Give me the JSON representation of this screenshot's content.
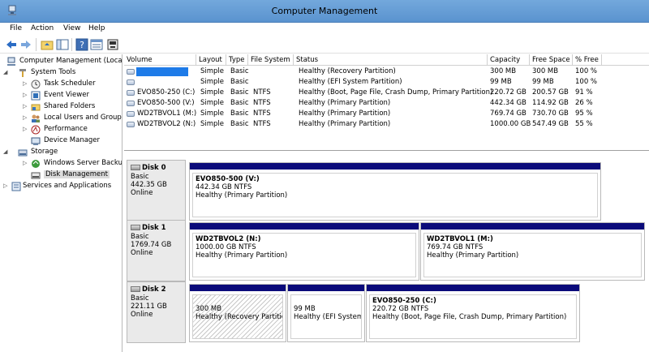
{
  "window": {
    "title": "Computer Management"
  },
  "menu": [
    {
      "label": "File"
    },
    {
      "label": "Action"
    },
    {
      "label": "View"
    },
    {
      "label": "Help"
    }
  ],
  "tree": {
    "root": "Computer Management (Local",
    "system_tools": "System Tools",
    "task_scheduler": "Task Scheduler",
    "event_viewer": "Event Viewer",
    "shared_folders": "Shared Folders",
    "local_users": "Local Users and Groups",
    "performance": "Performance",
    "device_manager": "Device Manager",
    "storage": "Storage",
    "wsb": "Windows Server Backup",
    "disk_management": "Disk Management",
    "services": "Services and Applications"
  },
  "volume_list": {
    "headers": {
      "volume": "Volume",
      "layout": "Layout",
      "type": "Type",
      "file_system": "File System",
      "status": "Status",
      "capacity": "Capacity",
      "free_space": "Free Space",
      "pct_free": "% Free"
    },
    "rows": [
      {
        "volume": "",
        "layout": "Simple",
        "type": "Basic",
        "fs": "",
        "status": "Healthy (Recovery Partition)",
        "capacity": "300 MB",
        "free": "300 MB",
        "pct": "100 %"
      },
      {
        "volume": "",
        "layout": "Simple",
        "type": "Basic",
        "fs": "",
        "status": "Healthy (EFI System Partition)",
        "capacity": "99 MB",
        "free": "99 MB",
        "pct": "100 %"
      },
      {
        "volume": "EVO850-250 (C:)",
        "layout": "Simple",
        "type": "Basic",
        "fs": "NTFS",
        "status": "Healthy (Boot, Page File, Crash Dump, Primary Partition)",
        "capacity": "220.72 GB",
        "free": "200.57 GB",
        "pct": "91 %"
      },
      {
        "volume": "EVO850-500 (V:)",
        "layout": "Simple",
        "type": "Basic",
        "fs": "NTFS",
        "status": "Healthy (Primary Partition)",
        "capacity": "442.34 GB",
        "free": "114.92 GB",
        "pct": "26 %"
      },
      {
        "volume": "WD2TBVOL1 (M:)",
        "layout": "Simple",
        "type": "Basic",
        "fs": "NTFS",
        "status": "Healthy (Primary Partition)",
        "capacity": "769.74 GB",
        "free": "730.70 GB",
        "pct": "95 %"
      },
      {
        "volume": "WD2TBVOL2 (N:)",
        "layout": "Simple",
        "type": "Basic",
        "fs": "NTFS",
        "status": "Healthy (Primary Partition)",
        "capacity": "1000.00 GB",
        "free": "547.49 GB",
        "pct": "55 %"
      }
    ]
  },
  "disks": [
    {
      "name": "Disk 0",
      "kind": "Basic",
      "size": "442.35 GB",
      "state": "Online",
      "partitions": [
        {
          "name": "EVO850-500  (V:)",
          "size": "442.34 GB NTFS",
          "status": "Healthy (Primary Partition)"
        }
      ]
    },
    {
      "name": "Disk 1",
      "kind": "Basic",
      "size": "1769.74 GB",
      "state": "Online",
      "partitions": [
        {
          "name": "WD2TBVOL2  (N:)",
          "size": "1000.00 GB NTFS",
          "status": "Healthy (Primary Partition)"
        },
        {
          "name": "WD2TBVOL1  (M:)",
          "size": "769.74 GB NTFS",
          "status": "Healthy (Primary Partition)"
        }
      ]
    },
    {
      "name": "Disk 2",
      "kind": "Basic",
      "size": "221.11 GB",
      "state": "Online",
      "partitions": [
        {
          "name": "",
          "size": "300 MB",
          "status": "Healthy (Recovery Partition"
        },
        {
          "name": "",
          "size": "99 MB",
          "status": "Healthy (EFI System P"
        },
        {
          "name": "EVO850-250  (C:)",
          "size": "220.72 GB NTFS",
          "status": "Healthy (Boot, Page File, Crash Dump, Primary Partition)"
        }
      ]
    }
  ],
  "colors": {
    "titlebar": "#6a9fd8",
    "partition_bar": "#0b0b7a",
    "redaction": "#1e7be8"
  }
}
